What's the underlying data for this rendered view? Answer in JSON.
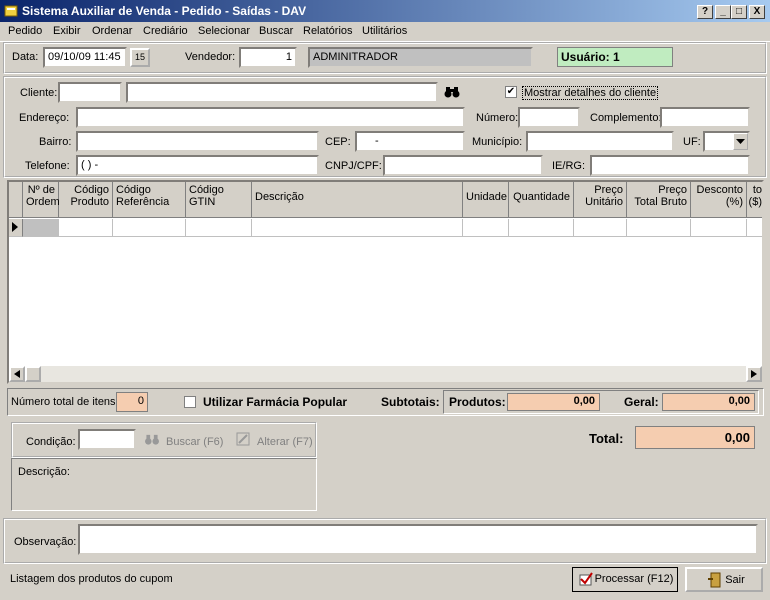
{
  "window": {
    "title": "Sistema Auxiliar de Venda - Pedido - Saídas - DAV",
    "controls": [
      "?",
      "_",
      "□",
      "X"
    ]
  },
  "menu": [
    "Pedido",
    "Exibir",
    "Ordenar",
    "Crediário",
    "Selecionar",
    "Buscar",
    "Relatórios",
    "Utilitários"
  ],
  "header": {
    "data_label": "Data:",
    "data_value": "09/10/09 11:45",
    "date_button": "15",
    "vendedor_label": "Vendedor:",
    "vendedor_code": "1",
    "vendedor_name": "ADMINITRADOR",
    "usuario": "Usuário: 1"
  },
  "cliente": {
    "cliente_label": "Cliente:",
    "mostrar_detalhes": "Mostrar detalhes do cliente",
    "endereco_label": "Endereço:",
    "numero_label": "Número:",
    "complemento_label": "Complemento:",
    "bairro_label": "Bairro:",
    "cep_label": "CEP:",
    "cep_value": "-",
    "municipio_label": "Município:",
    "uf_label": "UF:",
    "telefone_label": "Telefone:",
    "telefone_value": "( )   -",
    "cnpj_label": "CNPJ/CPF:",
    "ie_label": "IE/RG:"
  },
  "grid": {
    "columns": [
      {
        "line1": "Nº de",
        "line2": "Ordem"
      },
      {
        "line1": "Código",
        "line2": "Produto"
      },
      {
        "line1": "Código",
        "line2": "Referência"
      },
      {
        "line1": "Código",
        "line2": "GTIN"
      },
      {
        "line1": "Descrição",
        "line2": ""
      },
      {
        "line1": "Unidade",
        "line2": ""
      },
      {
        "line1": "Quantidade",
        "line2": ""
      },
      {
        "line1": "Preço",
        "line2": "Unitário"
      },
      {
        "line1": "Preço",
        "line2": "Total Bruto"
      },
      {
        "line1": "Desconto",
        "line2": "(%)"
      },
      {
        "line1": "to",
        "line2": "($)"
      }
    ]
  },
  "totals": {
    "num_itens_label": "Número total de itens:",
    "num_itens_value": "0",
    "farmacia_label": "Utilizar Farmácia Popular",
    "subtotais_label": "Subtotais:",
    "produtos_label": "Produtos:",
    "produtos_value": "0,00",
    "geral_label": "Geral:",
    "geral_value": "0,00",
    "total_label": "Total:",
    "total_value": "0,00"
  },
  "condicao": {
    "label": "Condição:",
    "buscar": "Buscar (F6)",
    "alterar": "Alterar (F7)",
    "descricao_label": "Descrição:"
  },
  "observacao_label": "Observação:",
  "status_text": "Listagem dos produtos do cupom",
  "buttons": {
    "processar": "Processar (F12)",
    "sair": "Sair"
  }
}
